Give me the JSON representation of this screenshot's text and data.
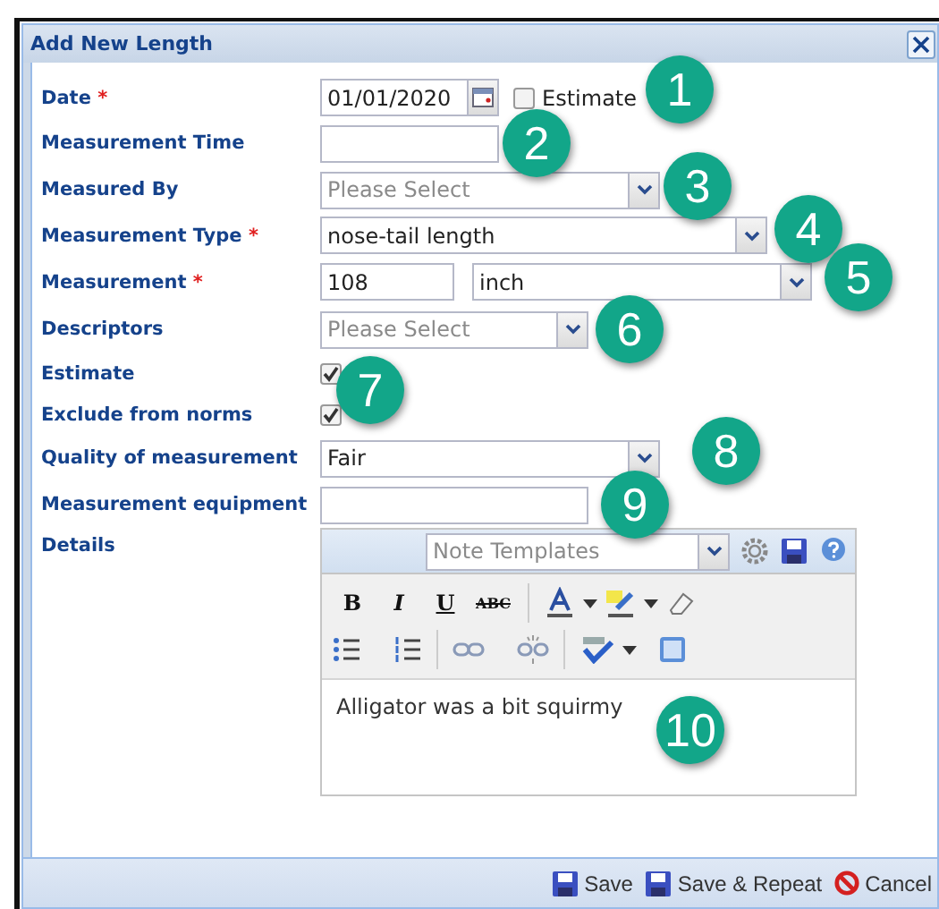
{
  "dialog": {
    "title": "Add New Length"
  },
  "fields": [
    {
      "kind": "date",
      "label": "Date",
      "marker": "*",
      "value": "01/01/2020",
      "estimate": {
        "label": "Estimate",
        "checked": false
      }
    },
    {
      "kind": "text",
      "label": "Measurement Time"
    },
    {
      "kind": "select",
      "label": "Measured By",
      "placeholder": "Please Select"
    },
    {
      "kind": "select",
      "label": "Measurement Type",
      "marker": "*",
      "value": "nose-tail length"
    },
    {
      "kind": "measure",
      "label": "Measurement",
      "marker": "*",
      "value": "108",
      "unit": "inch"
    },
    {
      "kind": "select",
      "label": "Descriptors",
      "placeholder": "Please Select"
    },
    {
      "kind": "checkbox",
      "label": "Estimate",
      "checked": true
    },
    {
      "kind": "checkbox",
      "label": "Exclude from norms",
      "checked": true
    },
    {
      "kind": "select",
      "label": "Quality of measurement",
      "value": "Fair"
    },
    {
      "kind": "text",
      "label": "Measurement equipment"
    },
    {
      "kind": "editor",
      "label": "Details",
      "templates_placeholder": "Note Templates",
      "format_buttons": [
        "B",
        "I",
        "U",
        "ABC"
      ],
      "content": "Alligator was a bit squirmy"
    }
  ],
  "footer_buttons": [
    {
      "kind": "save",
      "label": "Save"
    },
    {
      "kind": "save",
      "label": "Save & Repeat"
    },
    {
      "kind": "cancel",
      "label": "Cancel"
    }
  ],
  "callouts": [
    "1",
    "2",
    "3",
    "4",
    "5",
    "6",
    "7",
    "8",
    "9",
    "10"
  ]
}
